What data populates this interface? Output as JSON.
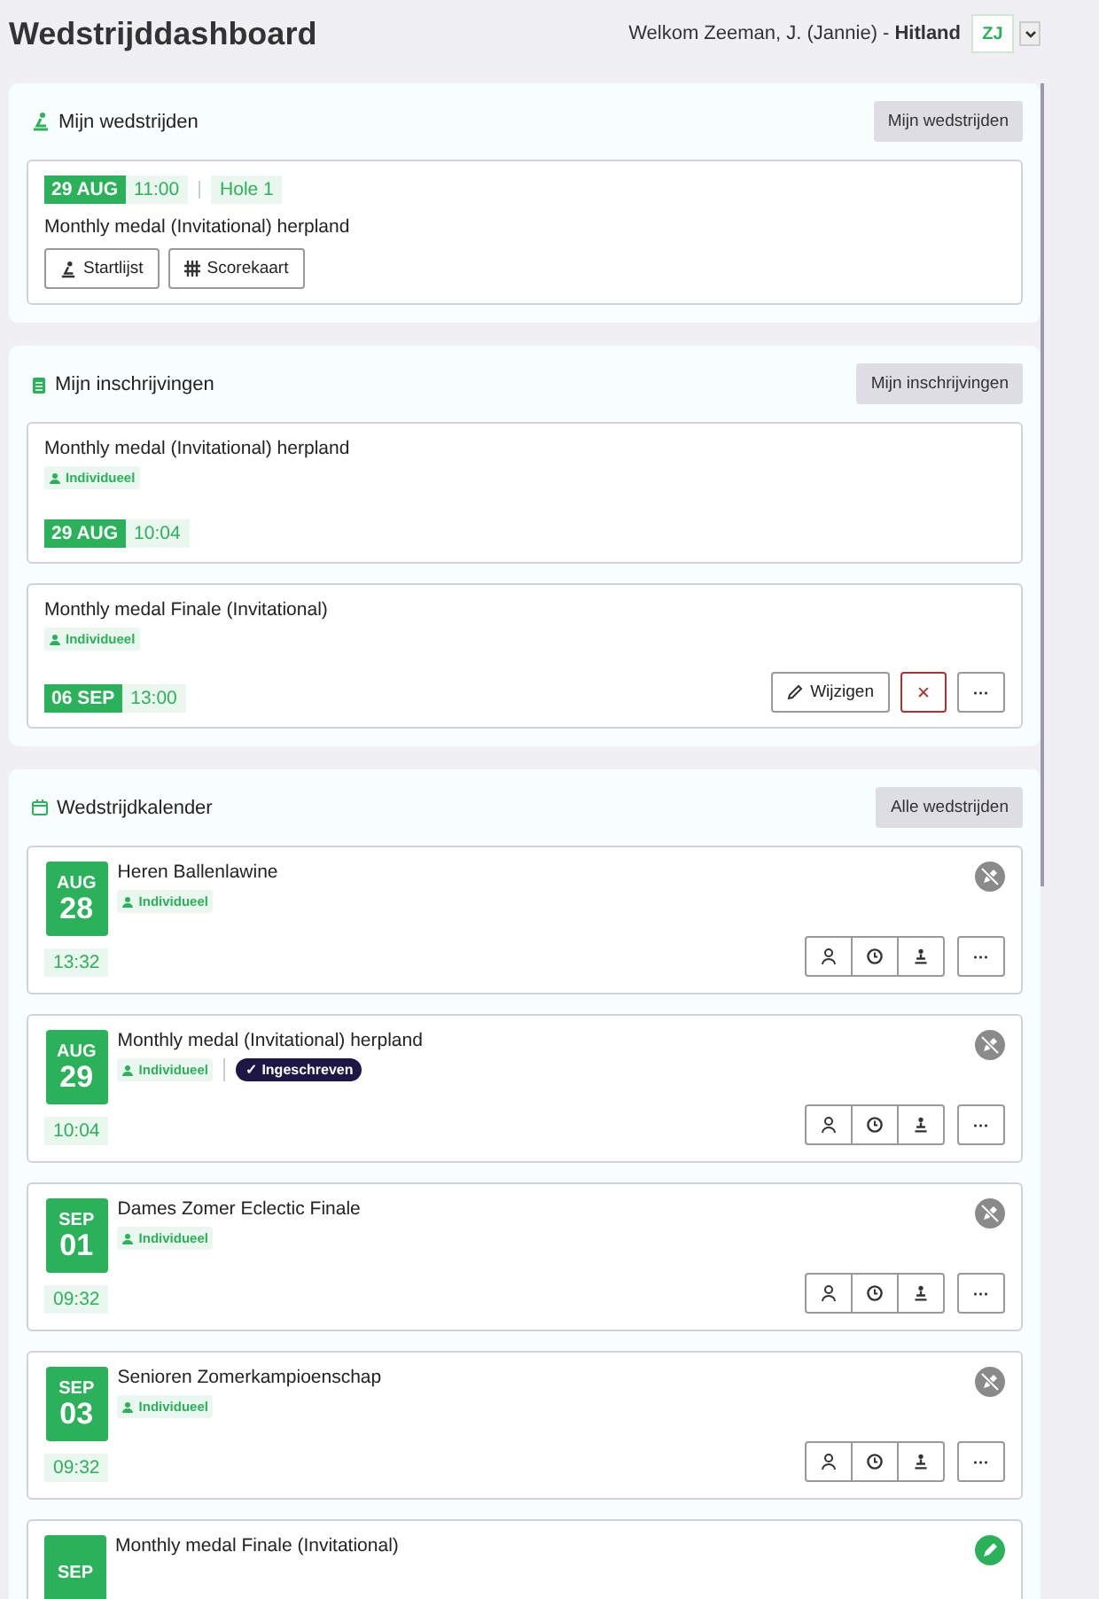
{
  "header": {
    "title": "Wedstrijddashboard",
    "welcome": "Welkom Zeeman, J. (Jannie) -",
    "club": "Hitland",
    "avatar": "ZJ"
  },
  "my_matches": {
    "title": "Mijn wedstrijden",
    "button": "Mijn wedstrijden",
    "items": [
      {
        "date": "29 AUG",
        "time": "11:00",
        "hole": "Hole 1",
        "name": "Monthly medal (Invitational) herpland",
        "actions": [
          "Startlijst",
          "Scorekaart"
        ]
      }
    ]
  },
  "my_entries": {
    "title": "Mijn inschrijvingen",
    "button": "Mijn inschrijvingen",
    "items": [
      {
        "name": "Monthly medal (Invitational) herpland",
        "type": "Individueel",
        "date": "29 AUG",
        "time": "10:04",
        "editable": false
      },
      {
        "name": "Monthly medal Finale (Invitational)",
        "type": "Individueel",
        "date": "06 SEP",
        "time": "13:00",
        "editable": true,
        "edit_label": "Wijzigen",
        "cancel_icon": "✕",
        "more_icon": "···"
      }
    ]
  },
  "calendar": {
    "title": "Wedstrijdkalender",
    "button": "Alle wedstrijden",
    "items": [
      {
        "month": "AUG",
        "day": "28",
        "name": "Heren Ballenlawine",
        "type": "Individueel",
        "time": "13:32",
        "kind": "closed",
        "more_icon": "···"
      },
      {
        "month": "AUG",
        "day": "29",
        "name": "Monthly medal (Invitational) herpland",
        "type": "Individueel",
        "badge": "✓ Ingeschreven",
        "time": "10:04",
        "kind": "closed",
        "more_icon": "···"
      },
      {
        "month": "SEP",
        "day": "01",
        "name": "Dames Zomer Eclectic Finale",
        "type": "Individueel",
        "time": "09:32",
        "kind": "closed",
        "more_icon": "···"
      },
      {
        "month": "SEP",
        "day": "03",
        "name": "Senioren Zomerkampioenschap",
        "type": "Individueel",
        "time": "09:32",
        "kind": "closed",
        "more_icon": "···"
      },
      {
        "month": "SEP",
        "name": "Monthly medal Finale (Invitational)",
        "kind": "open"
      }
    ]
  }
}
